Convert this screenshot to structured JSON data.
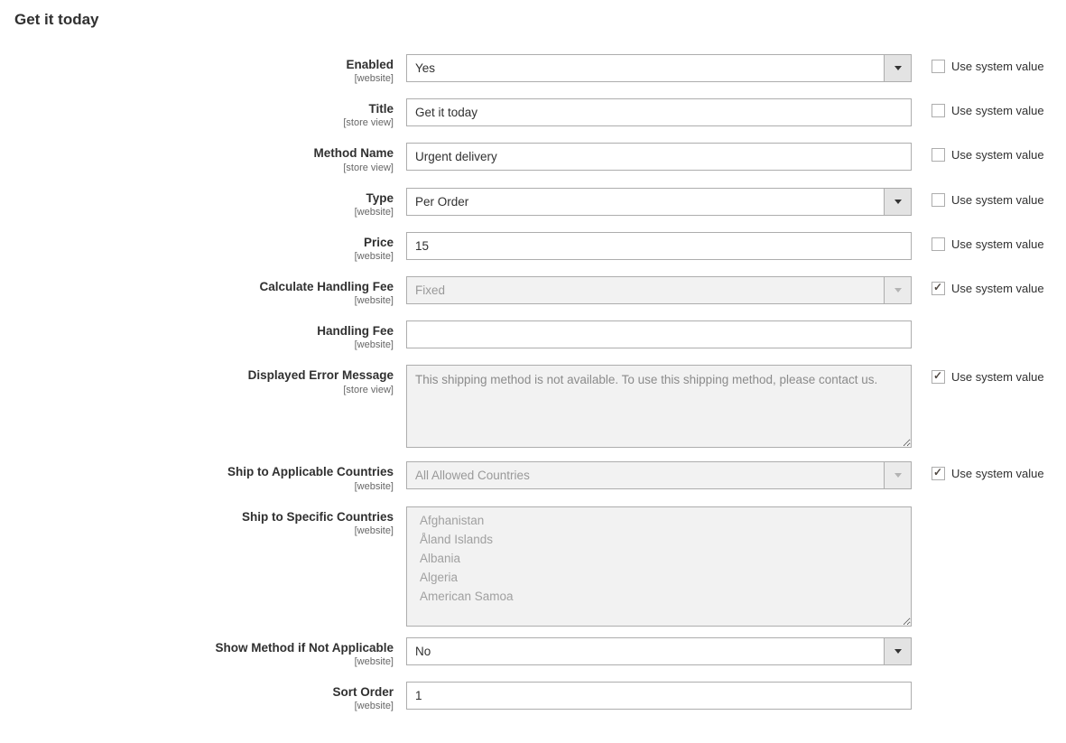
{
  "section_title": "Get it today",
  "use_system_value_label": "Use system value",
  "fields": {
    "enabled": {
      "label": "Enabled",
      "scope": "[website]",
      "value": "Yes"
    },
    "title": {
      "label": "Title",
      "scope": "[store view]",
      "value": "Get it today"
    },
    "method": {
      "label": "Method Name",
      "scope": "[store view]",
      "value": "Urgent delivery"
    },
    "type": {
      "label": "Type",
      "scope": "[website]",
      "value": "Per Order"
    },
    "price": {
      "label": "Price",
      "scope": "[website]",
      "value": "15"
    },
    "calc_fee": {
      "label": "Calculate Handling Fee",
      "scope": "[website]",
      "value": "Fixed"
    },
    "hand_fee": {
      "label": "Handling Fee",
      "scope": "[website]",
      "value": ""
    },
    "err_msg": {
      "label": "Displayed Error Message",
      "scope": "[store view]",
      "value": "This shipping method is not available. To use this shipping method, please contact us."
    },
    "ship_app": {
      "label": "Ship to Applicable Countries",
      "scope": "[website]",
      "value": "All Allowed Countries"
    },
    "ship_spec": {
      "label": "Ship to Specific Countries",
      "scope": "[website]"
    },
    "show_na": {
      "label": "Show Method if Not Applicable",
      "scope": "[website]",
      "value": "No"
    },
    "sort": {
      "label": "Sort Order",
      "scope": "[website]",
      "value": "1"
    }
  },
  "countries": [
    "Afghanistan",
    "Åland Islands",
    "Albania",
    "Algeria",
    "American Samoa"
  ]
}
